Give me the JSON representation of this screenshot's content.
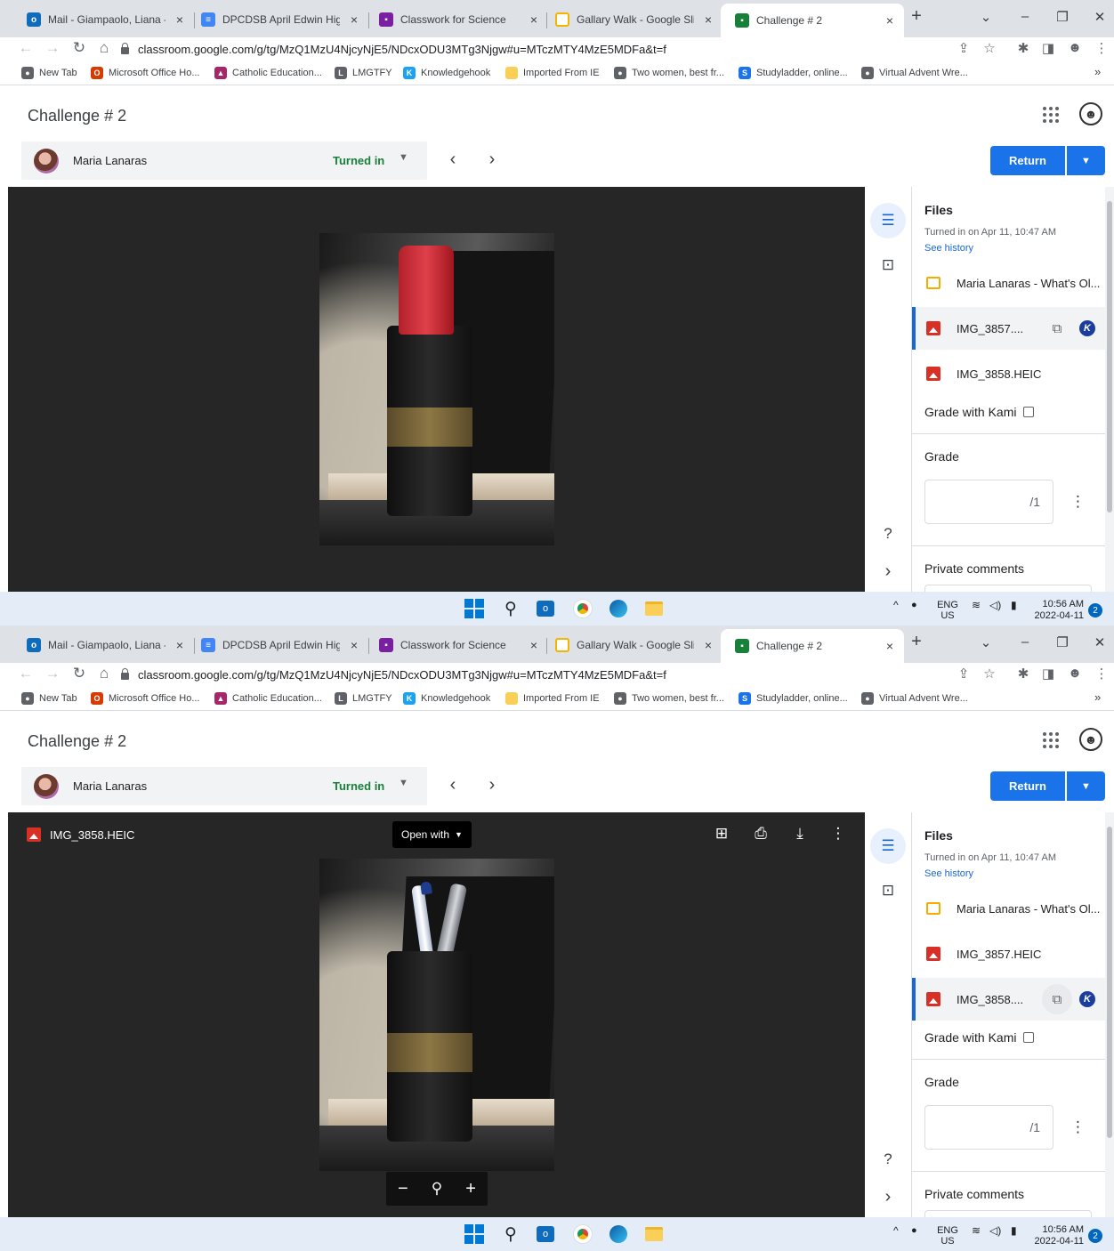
{
  "browser": {
    "tabs": [
      {
        "title": "Mail - Giampaolo, Liana - Ou",
        "icon": "outlook-icon",
        "color": "#0f6cbd"
      },
      {
        "title": "DPCDSB April Edwin Highligh",
        "icon": "docs-icon",
        "color": "#4285f4"
      },
      {
        "title": "Classwork for Science",
        "icon": "classroom-icon",
        "color": "#7b1fa2"
      },
      {
        "title": "Gallary Walk - Google Slides",
        "icon": "slides-icon",
        "color": "#f4b400"
      },
      {
        "title": "Challenge # 2",
        "icon": "classroom-icon",
        "color": "#188038",
        "active": true
      }
    ],
    "close_glyph": "×",
    "new_tab_glyph": "+",
    "url": "classroom.google.com/g/tg/MzQ1MzU4NjcyNjE5/NDcxODU3MTg3Njgw#u=MTczMTY4MzE5MDFa&t=f",
    "bookmarks": [
      {
        "label": "New Tab",
        "color": "#5f6368"
      },
      {
        "label": "Microsoft Office Ho...",
        "color": "#d83b01"
      },
      {
        "label": "Catholic Education...",
        "color": "#a4266b"
      },
      {
        "label": "LMGTFY",
        "color": "#5f6368"
      },
      {
        "label": "Knowledgehook",
        "color": "#1da1f2"
      },
      {
        "label": "Imported From IE",
        "color": "#f9cf57"
      },
      {
        "label": "Two women, best fr...",
        "color": "#5f6368"
      },
      {
        "label": "Studyladder, online...",
        "color": "#1a73e8"
      },
      {
        "label": "Virtual Advent Wre...",
        "color": "#5f6368"
      }
    ],
    "bookmarks_overflow": "»"
  },
  "app": {
    "title": "Challenge # 2",
    "student_name": "Maria Lanaras",
    "status": "Turned in",
    "return_label": "Return",
    "accent_color": "#1a73e8"
  },
  "panel": {
    "files_heading": "Files",
    "turned_in_text": "Turned in on Apr 11, 10:47 AM",
    "see_history": "See history",
    "grade_with_kami": "Grade with Kami",
    "grade_heading": "Grade",
    "grade_value": "",
    "grade_denominator": "/1",
    "private_comments": "Private comments"
  },
  "shots": [
    {
      "files": [
        {
          "name": "Maria Lanaras - What's Ol...",
          "type": "slides"
        },
        {
          "name": "IMG_3857....",
          "type": "image",
          "selected": true
        },
        {
          "name": "IMG_3858.HEIC",
          "type": "image"
        }
      ],
      "viewer": {
        "photo": "red-cap-tube"
      }
    },
    {
      "files": [
        {
          "name": "Maria Lanaras - What's Ol...",
          "type": "slides"
        },
        {
          "name": "IMG_3857.HEIC",
          "type": "image"
        },
        {
          "name": "IMG_3858....",
          "type": "image",
          "selected": true
        }
      ],
      "viewer": {
        "photo": "pens-tube",
        "file_name": "IMG_3858.HEIC",
        "open_with": "Open with"
      }
    }
  ],
  "taskbar": {
    "lang_top": "ENG",
    "lang_bottom": "US",
    "time": "10:56 AM",
    "date": "2022-04-11",
    "notification_count": "2"
  }
}
